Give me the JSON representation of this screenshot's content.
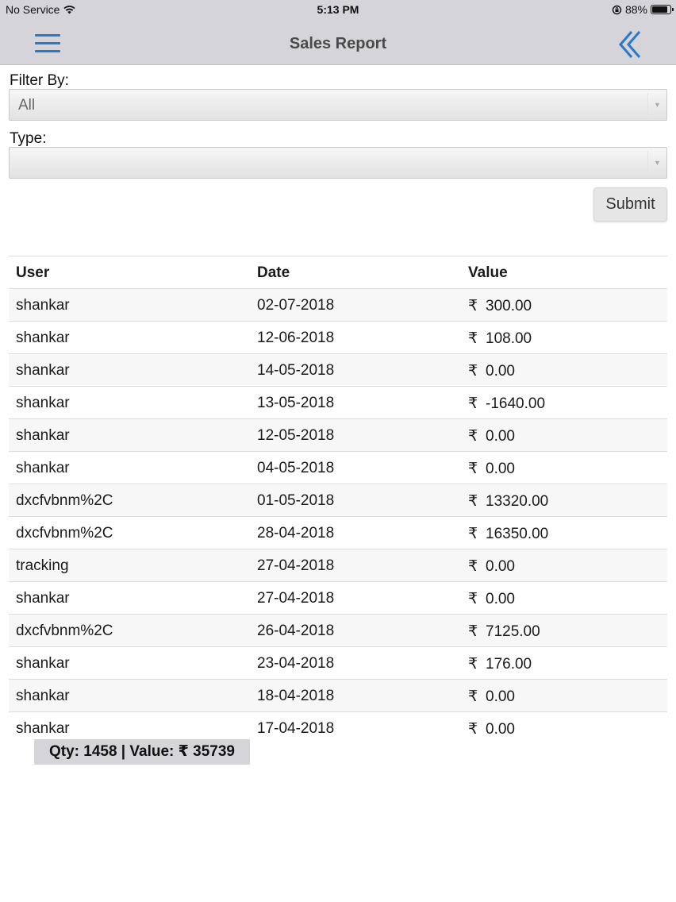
{
  "status_bar": {
    "carrier": "No Service",
    "time": "5:13 PM",
    "battery": "88%",
    "battery_level": 0.88
  },
  "nav": {
    "title": "Sales Report",
    "menu_icon": "hamburger-menu-icon",
    "back_icon": "double-chevron-left-icon",
    "accent_color": "#2a78c8"
  },
  "filter": {
    "label": "Filter By:",
    "value": "All"
  },
  "type_filter": {
    "label": "Type:",
    "value": ""
  },
  "submit_label": "Submit",
  "table": {
    "headers": [
      "User",
      "Date",
      "Value"
    ],
    "currency_symbol": "₹",
    "rows": [
      {
        "user": "shankar",
        "date": "02-07-2018",
        "value": "300.00"
      },
      {
        "user": "shankar",
        "date": "12-06-2018",
        "value": "108.00"
      },
      {
        "user": "shankar",
        "date": "14-05-2018",
        "value": "0.00"
      },
      {
        "user": "shankar",
        "date": "13-05-2018",
        "value": "-1640.00"
      },
      {
        "user": "shankar",
        "date": "12-05-2018",
        "value": "0.00"
      },
      {
        "user": "shankar",
        "date": "04-05-2018",
        "value": "0.00"
      },
      {
        "user": "dxcfvbnm%2C",
        "date": "01-05-2018",
        "value": "13320.00"
      },
      {
        "user": "dxcfvbnm%2C",
        "date": "28-04-2018",
        "value": "16350.00"
      },
      {
        "user": "tracking",
        "date": "27-04-2018",
        "value": "0.00"
      },
      {
        "user": "shankar",
        "date": "27-04-2018",
        "value": "0.00"
      },
      {
        "user": "dxcfvbnm%2C",
        "date": "26-04-2018",
        "value": "7125.00"
      },
      {
        "user": "shankar",
        "date": "23-04-2018",
        "value": "176.00"
      },
      {
        "user": "shankar",
        "date": "18-04-2018",
        "value": "0.00"
      },
      {
        "user": "shankar",
        "date": "17-04-2018",
        "value": "0.00"
      }
    ]
  },
  "summary": "Qty: 1458 | Value: ₹ 35739"
}
